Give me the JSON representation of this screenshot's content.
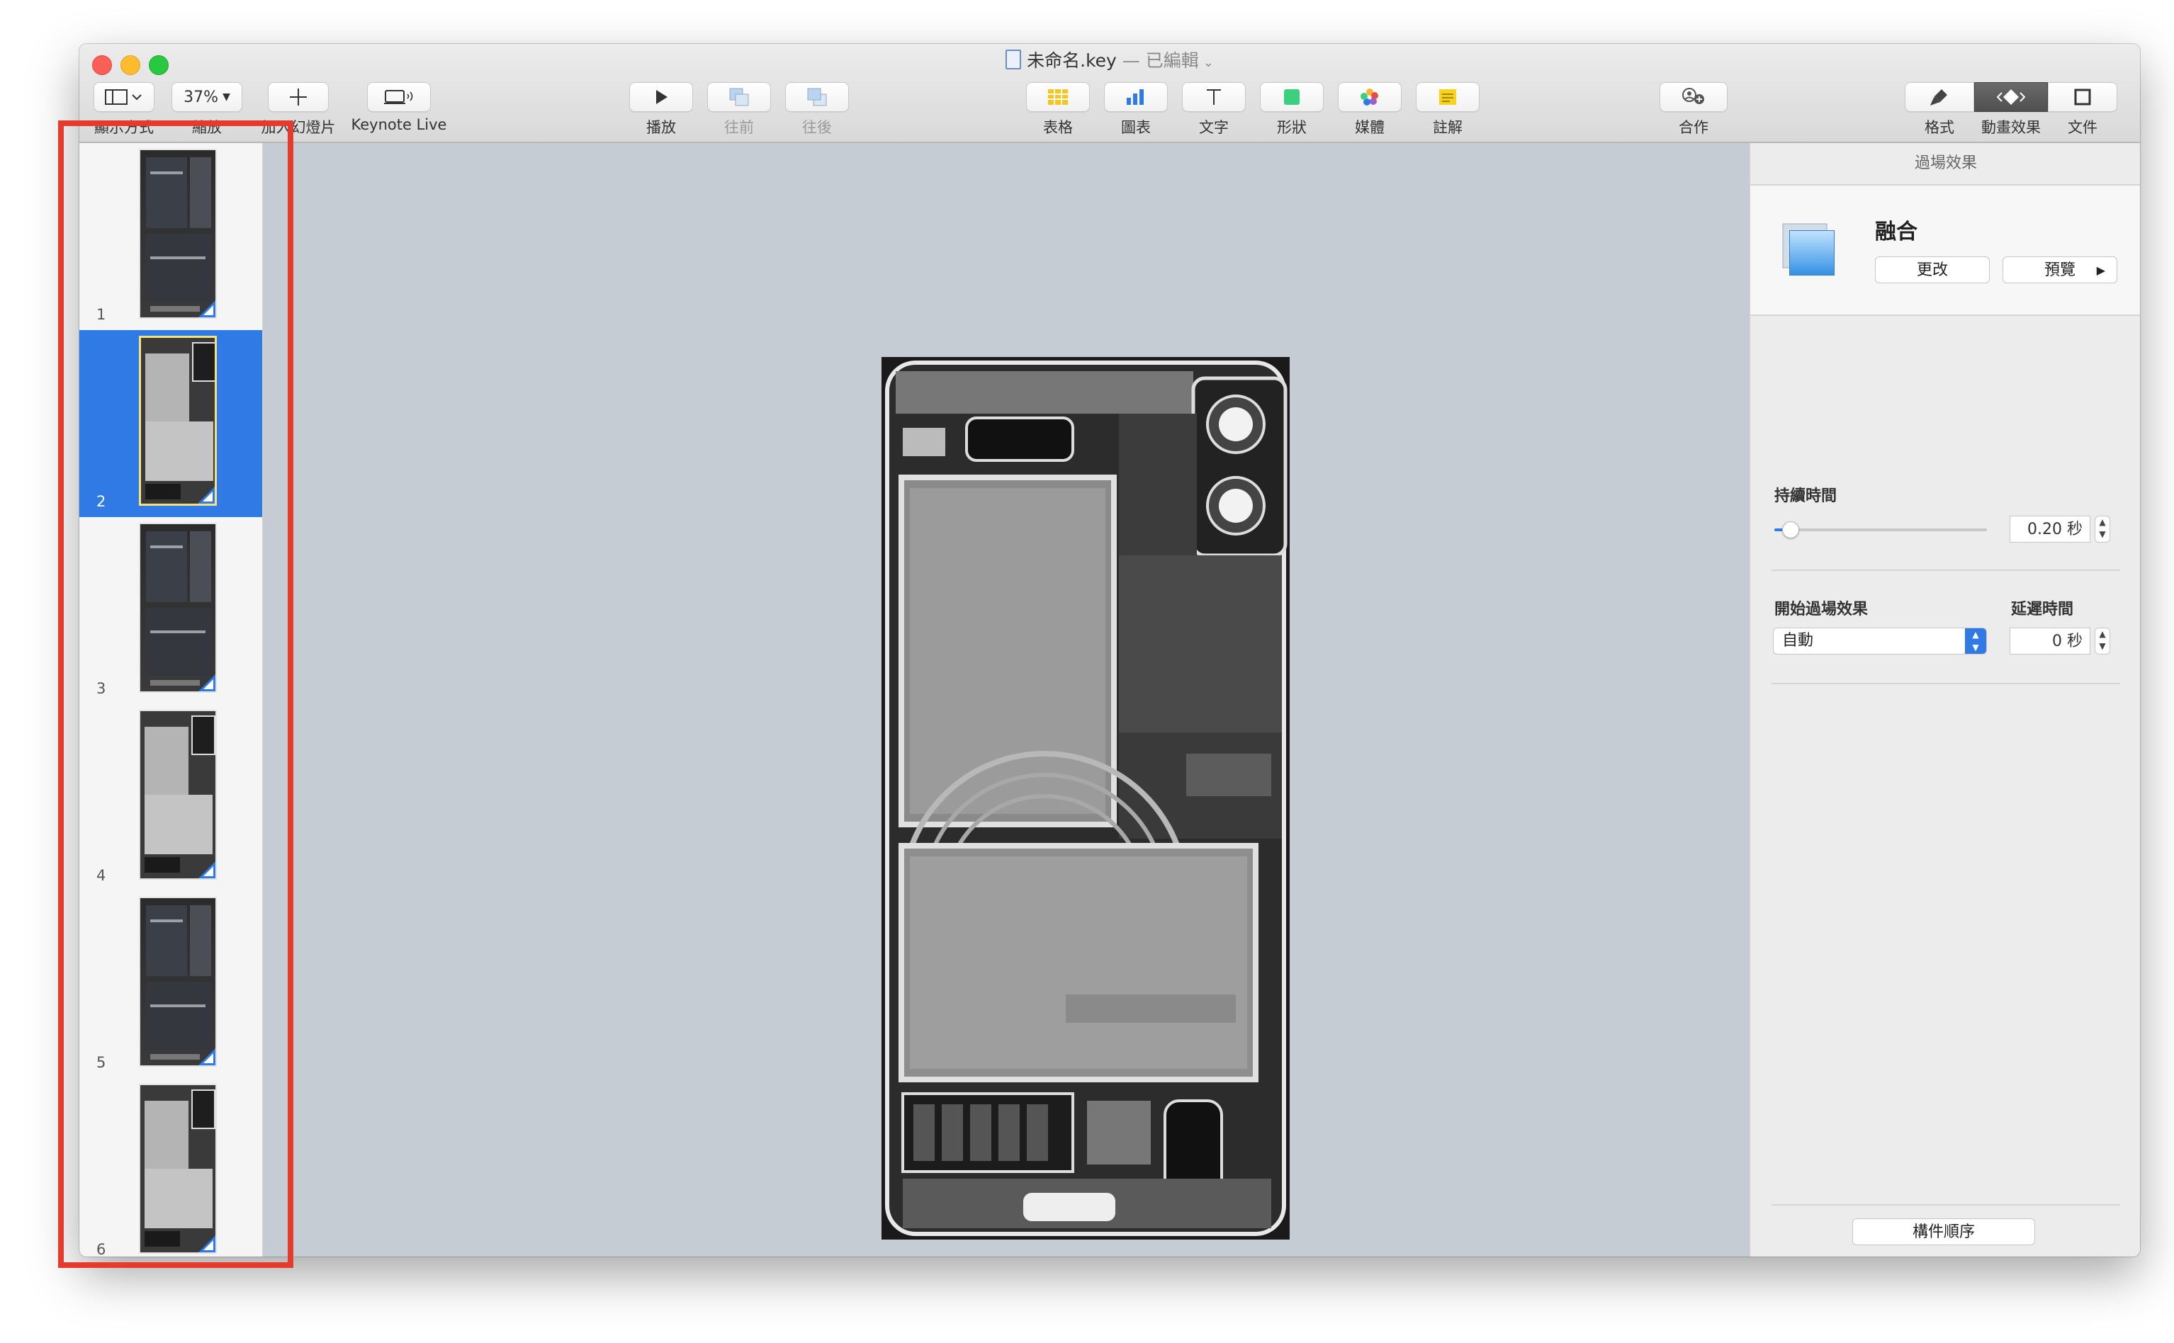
{
  "window": {
    "title_name": "未命名.key",
    "title_sep": " — ",
    "title_status": "已編輯",
    "title_chevron": "⌄"
  },
  "toolbar": {
    "view_label": "顯示方式",
    "zoom_value": "37%",
    "zoom_label": "縮放",
    "add_slide_label": "加入幻燈片",
    "keynote_live_label": "Keynote Live",
    "play_label": "播放",
    "back_label": "往前",
    "front_label": "往後",
    "table_label": "表格",
    "chart_label": "圖表",
    "text_label": "文字",
    "shape_label": "形狀",
    "media_label": "媒體",
    "comment_label": "註解",
    "collaborate_label": "合作",
    "format_label": "格式",
    "animate_label": "動畫效果",
    "document_label": "文件"
  },
  "slides": [
    {
      "number": "1",
      "style": "dark"
    },
    {
      "number": "2",
      "style": "light",
      "selected": true
    },
    {
      "number": "3",
      "style": "dark"
    },
    {
      "number": "4",
      "style": "light"
    },
    {
      "number": "5",
      "style": "dark"
    },
    {
      "number": "6",
      "style": "light"
    }
  ],
  "inspector": {
    "tab_title": "過場效果",
    "effect_name": "融合",
    "change_button": "更改",
    "preview_button": "預覽",
    "duration_label": "持續時間",
    "duration_value": "0.20 秒",
    "duration_fraction": 0.04,
    "start_label": "開始過場效果",
    "start_value": "自動",
    "delay_label": "延遲時間",
    "delay_value": "0 秒",
    "build_order_button": "構件順序"
  },
  "colors": {
    "selection_blue": "#2f7ae5",
    "annotation_red": "#e53b2c"
  }
}
